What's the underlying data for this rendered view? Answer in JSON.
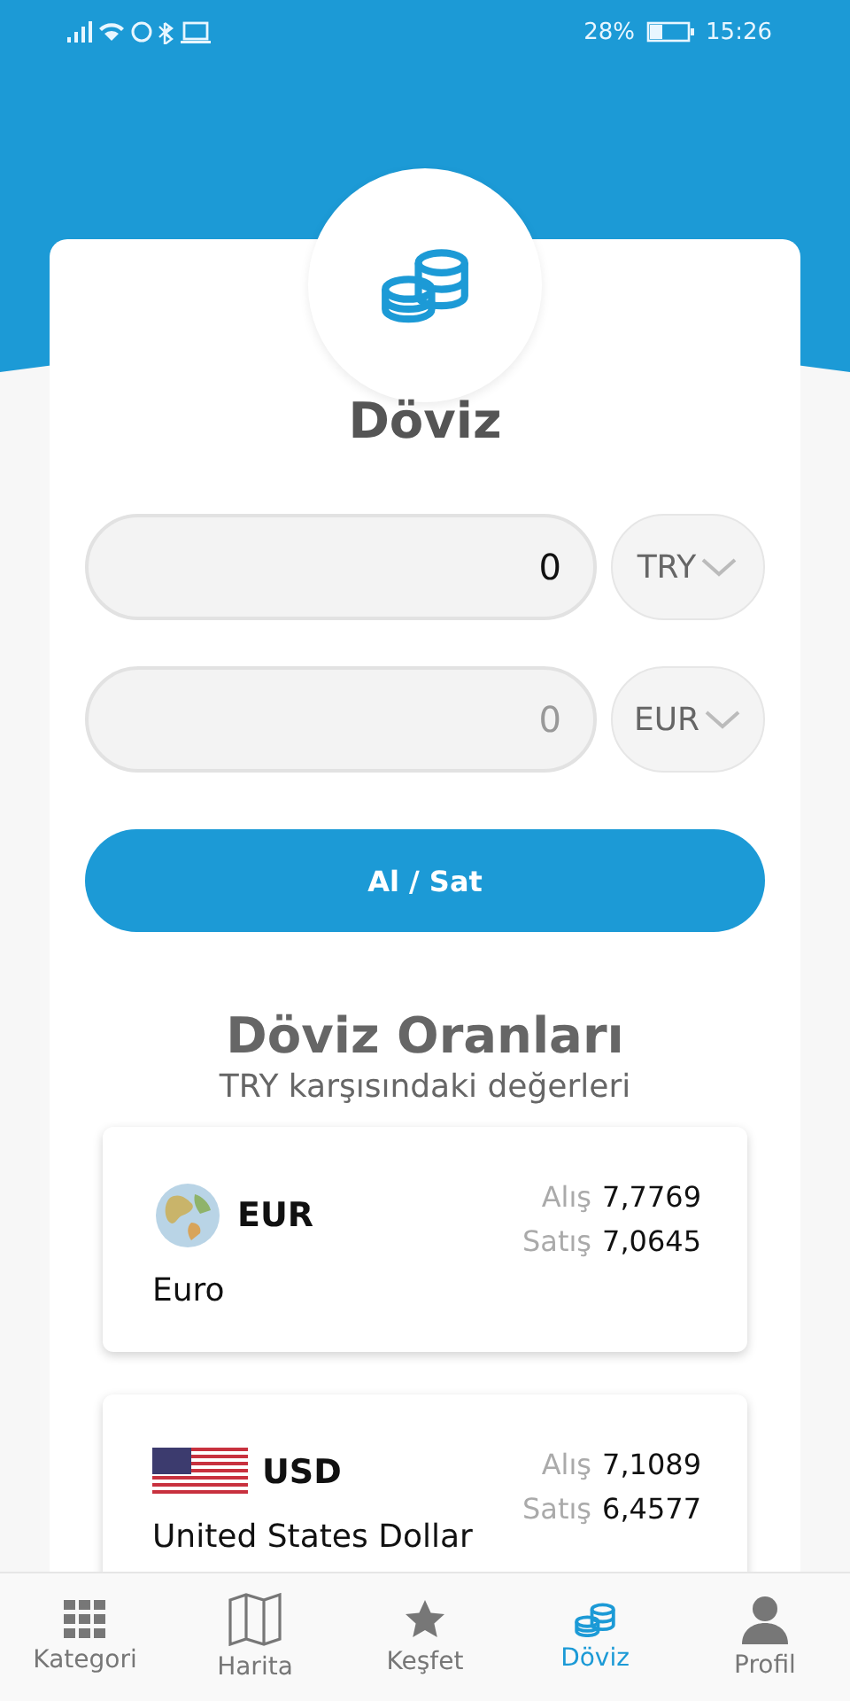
{
  "status_bar": {
    "battery": "28%",
    "time": "15:26"
  },
  "title": "Döviz",
  "converter": {
    "rows": [
      {
        "amount": "0",
        "placeholder": "",
        "currency": "TRY"
      },
      {
        "amount": "",
        "placeholder": "0",
        "currency": "EUR"
      }
    ],
    "button": "Al / Sat"
  },
  "rates": {
    "title": "Döviz Oranları",
    "subtitle": "TRY karşısındaki değerleri",
    "items": [
      {
        "kind": "globe",
        "code": "EUR",
        "name": "Euro",
        "buy_label": "Alış",
        "buy": "7,7769",
        "sell_label": "Satış",
        "sell": "7,0645"
      },
      {
        "kind": "flag",
        "code": "USD",
        "name": "United States Dollar",
        "buy_label": "Alış",
        "buy": "7,1089",
        "sell_label": "Satış",
        "sell": "6,4577"
      }
    ]
  },
  "nav": [
    {
      "kind": "grid",
      "label": "Kategori",
      "selected": false
    },
    {
      "kind": "map",
      "label": "Harita",
      "selected": false
    },
    {
      "kind": "star",
      "label": "Keşfet",
      "selected": false
    },
    {
      "kind": "coins",
      "label": "Döviz",
      "selected": true
    },
    {
      "kind": "user",
      "label": "Profil",
      "selected": false
    }
  ]
}
